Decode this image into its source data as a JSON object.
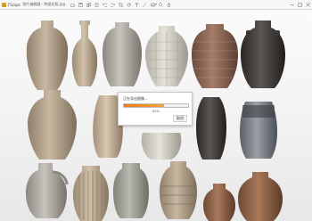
{
  "window": {
    "app_name": "FScapt",
    "file_name": "图片编辑器 - 陶瓷花瓶.jpg"
  },
  "toolbar": {
    "tools": [
      "open-icon",
      "save-icon",
      "copy-icon",
      "paste-icon",
      "undo-icon",
      "redo-icon",
      "crop-icon",
      "rotate-icon",
      "text-icon",
      "brush-icon",
      "image-icon",
      "zoom-icon",
      "delete-icon"
    ]
  },
  "dialog": {
    "message": "正在导出图像...",
    "progress": 0.62,
    "progress_text": "62%",
    "cancel_label": "取消"
  },
  "colors": {
    "progress_fill": "#f07a1a",
    "background": "#f1f1f1"
  }
}
